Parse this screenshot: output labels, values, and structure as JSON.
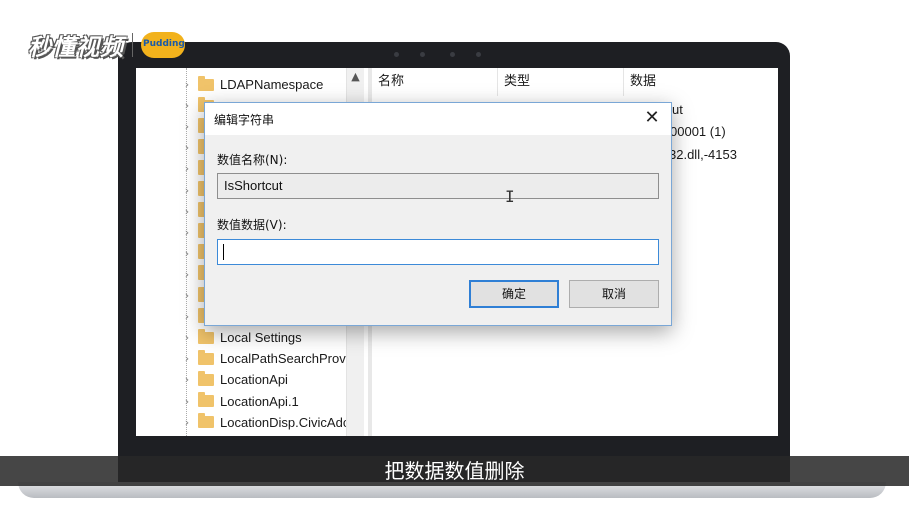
{
  "watermark": {
    "logo_text": "秒懂视频",
    "brand_text": "Pudding"
  },
  "tree": {
    "items": [
      {
        "label": "LDAPNamespace",
        "icon": "folder-icon"
      },
      {
        "label": "",
        "icon": "folder-icon"
      },
      {
        "label": "",
        "icon": "folder-icon"
      },
      {
        "label": "",
        "icon": "folder-icon"
      },
      {
        "label": "",
        "icon": "folder-icon"
      },
      {
        "label": "",
        "icon": "folder-icon"
      },
      {
        "label": "",
        "icon": "folder-icon"
      },
      {
        "label": "",
        "icon": "folder-icon"
      },
      {
        "label": "",
        "icon": "folder-icon"
      },
      {
        "label": "",
        "icon": "folder-icon"
      },
      {
        "label": "",
        "icon": "folder-icon"
      },
      {
        "label": "",
        "icon": "folder-icon"
      },
      {
        "label": "Local Settings",
        "icon": "folder-icon"
      },
      {
        "label": "LocalPathSearchProvi",
        "icon": "folder-icon"
      },
      {
        "label": "LocationApi",
        "icon": "folder-icon"
      },
      {
        "label": "LocationApi.1",
        "icon": "folder-icon"
      },
      {
        "label": "LocationDisp.CivicAdc",
        "icon": "folder-icon"
      }
    ]
  },
  "list": {
    "headers": {
      "name": "名称",
      "type": "类型",
      "data": "数据"
    },
    "visible_data": [
      "ut",
      "00001 (1)",
      "32.dll,-4153"
    ]
  },
  "dialog": {
    "title": "编辑字符串",
    "name_label": "数值名称(N):",
    "name_value": "IsShortcut",
    "data_label": "数值数据(V):",
    "data_value": "",
    "ok_label": "确定",
    "cancel_label": "取消"
  },
  "subtitle": {
    "text": "把数据数值删除"
  },
  "colors": {
    "folder": "#f0c36a",
    "accent": "#2f7fd5",
    "subtitle_bg": "#282828"
  }
}
